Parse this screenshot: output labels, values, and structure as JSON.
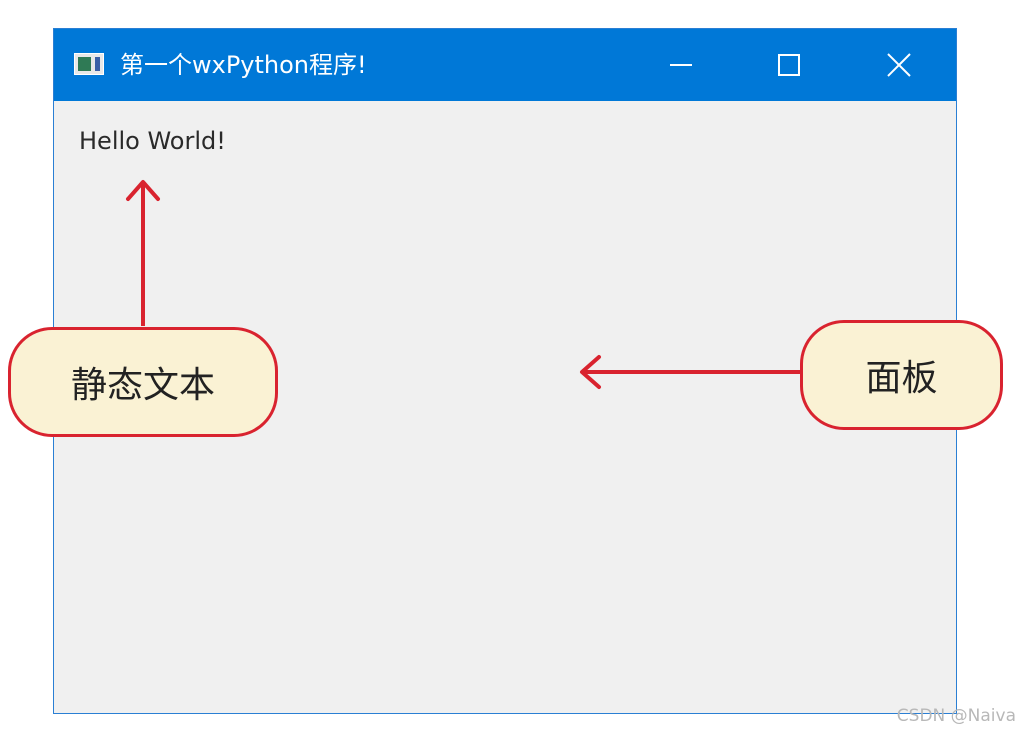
{
  "window": {
    "title": "第一个wxPython程序!",
    "icon": "app-window-icon",
    "controls": {
      "minimize_icon": "minimize-icon",
      "maximize_icon": "maximize-icon",
      "close_icon": "close-icon"
    },
    "titlebar_color": "#0078d7",
    "client_bg": "#f0f0f0"
  },
  "panel": {
    "static_text": "Hello World!"
  },
  "annotations": {
    "static_text_label": "静态文本",
    "panel_label": "面板",
    "accent_color": "#d9232f",
    "callout_fill": "#faf2d4"
  },
  "watermark": "CSDN @Naiva"
}
